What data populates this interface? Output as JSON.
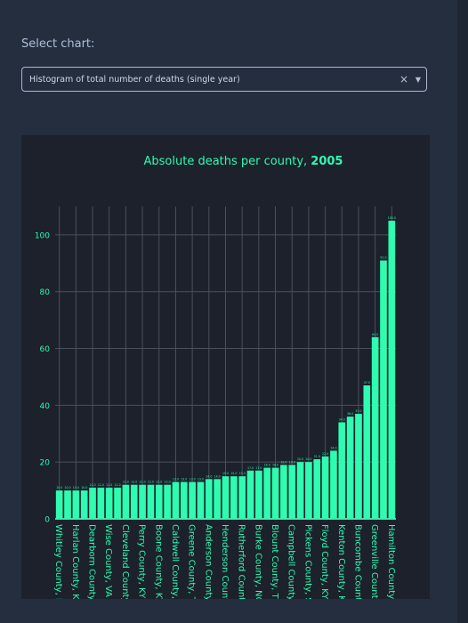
{
  "selector": {
    "label": "Select chart:",
    "value": "Histogram of total number of deaths (single year)",
    "clear_icon": "close-icon",
    "caret_icon": "chevron-down-icon"
  },
  "chart_data": {
    "type": "bar",
    "title_prefix": "Absolute deaths per county, ",
    "title_year": "2005",
    "ylim": [
      0,
      110
    ],
    "yticks": [
      0,
      20,
      40,
      60,
      80,
      100
    ],
    "grid": true,
    "bar_color": "#2dfcb1",
    "text_color": "#2dfcb1",
    "categories": [
      "Whitley County, KY",
      "",
      "Harlan County, KY",
      "",
      "Dearborn County, IN",
      "",
      "Wise County, VA",
      "",
      "Cleveland County, NC",
      "",
      "Perry County, KY",
      "",
      "Boone County, KY",
      "",
      "Caldwell County, NC",
      "",
      "Greene County, TN",
      "",
      "Anderson County, TN",
      "",
      "Henderson County, NC",
      "",
      "Rutherford County, NC",
      "",
      "Burke County, NC",
      "",
      "Blount County, TN",
      "",
      "Campbell County, KY",
      "",
      "Pickens County, SC",
      "",
      "Floyd County, KY",
      "",
      "Kenton County, KY",
      "",
      "Buncombe County, NC",
      "",
      "Greenville County, SC",
      "",
      "Hamilton County, OH"
    ],
    "values": [
      10,
      10,
      10,
      10,
      11,
      11,
      11,
      11,
      12,
      12,
      12,
      12,
      12,
      12,
      13,
      13,
      13,
      13,
      14,
      14,
      15,
      15,
      15,
      17,
      17,
      18,
      18,
      19,
      19,
      20,
      20,
      21,
      22,
      24,
      34,
      36,
      37,
      47,
      64,
      91,
      105
    ],
    "data_labels": [
      "10.0",
      "10.0",
      "10.0",
      "10.0",
      "11.0",
      "11.0",
      "11.0",
      "11.0",
      "12.0",
      "12.0",
      "12.0",
      "12.0",
      "12.0",
      "12.0",
      "13.0",
      "13.0",
      "13.0",
      "13.0",
      "14.0",
      "14.0",
      "15.0",
      "15.0",
      "15.0",
      "17.0",
      "17.0",
      "18.0",
      "18.0",
      "19.0",
      "19.0",
      "20.0",
      "20.0",
      "21.0",
      "22.0",
      "24.0",
      "34.0",
      "36.0",
      "37.0",
      "47.0",
      "64.0",
      "91.0",
      "105.0"
    ]
  }
}
